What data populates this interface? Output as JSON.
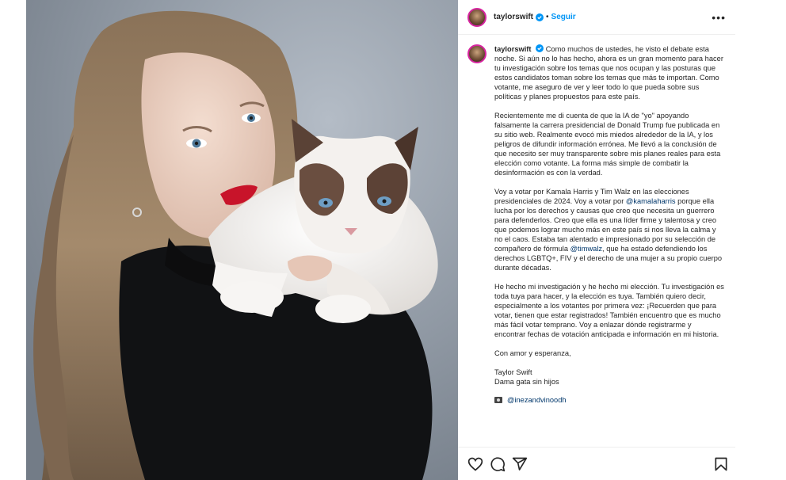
{
  "post": {
    "username": "taylorswift",
    "follow_label": "Seguir",
    "separator": "•",
    "more_label": "•••"
  },
  "caption": {
    "username": "taylorswift",
    "paragraphs": [
      "Como muchos de ustedes, he visto el debate esta noche. Si aún no lo has hecho, ahora es un gran momento para hacer tu investigación sobre los temas que nos ocupan y las posturas que estos candidatos toman sobre los temas que más te importan. Como votante, me aseguro de ver y leer todo lo que pueda sobre sus políticas y planes propuestos para este país.",
      "Recientemente me di cuenta de que la IA de \"yo\" apoyando falsamente la carrera presidencial de Donald Trump fue publicada en su sitio web. Realmente evocó mis miedos alrededor de la IA, y los peligros de difundir información errónea. Me llevó a la conclusión de que necesito ser muy transparente sobre mis planes reales para esta elección como votante. La forma más simple de combatir la desinformación es con la verdad.",
      "He hecho mi investigación y he hecho mi elección. Tu investigación es toda tuya para hacer, y la elección es tuya. También quiero decir, especialmente a los votantes por primera vez: ¡Recuerden que para votar, tienen que estar registrados! También encuentro que es mucho más fácil votar temprano. Voy a enlazar dónde registrarme y encontrar fechas de votación anticipada e información en mi historia.",
      "Con amor y esperanza,"
    ],
    "p3": {
      "part1": "Voy a votar por Kamala Harris y Tim Walz en las elecciones presidenciales de 2024. Voy a votar por ",
      "mention1": "@kamalaharris",
      "part2": " porque ella lucha por los derechos y causas que creo que necesita un guerrero para defenderlos. Creo que ella es una líder firme y talentosa y creo que podemos lograr mucho más en este país si nos lleva la calma y no el caos. Estaba tan alentado e impresionado por su selección de compañero de fórmula ",
      "mention2": "@timwalz",
      "part3": ", que ha estado defendiendo los derechos LGBTQ+, FIV y el derecho de una mujer a su propio cuerpo durante décadas."
    },
    "signature_line1": "Taylor Swift",
    "signature_line2": "Dama gata sin hijos",
    "photo_credit": "@inezandvinoodh"
  },
  "colors": {
    "link": "#0095f6",
    "mention": "#00376b",
    "avatar_ring": "#d6249f"
  },
  "icons": [
    "verified-badge-icon",
    "like-heart-icon",
    "comment-icon",
    "share-icon",
    "save-bookmark-icon",
    "camera-icon"
  ]
}
